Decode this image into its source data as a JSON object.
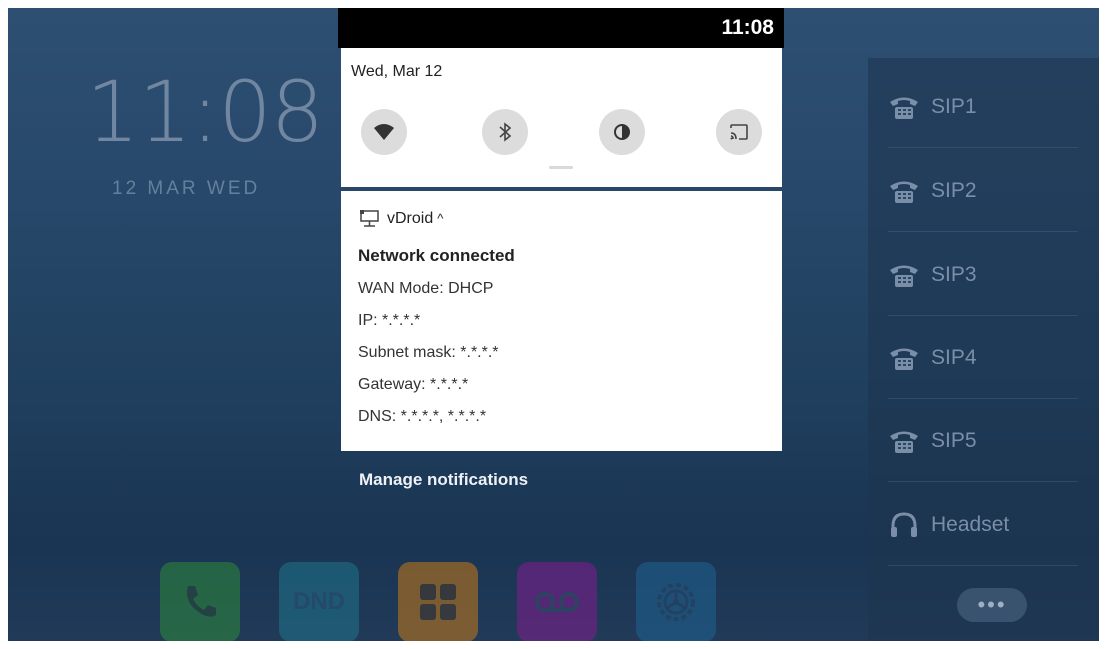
{
  "statusbar": {
    "time": "11:08"
  },
  "home": {
    "clock": "11:08",
    "date": "12 MAR WED"
  },
  "quick_settings": {
    "date": "Wed, Mar 12",
    "tiles": [
      {
        "icon": "wifi-icon"
      },
      {
        "icon": "bluetooth-icon"
      },
      {
        "icon": "contrast-icon"
      },
      {
        "icon": "cast-icon"
      }
    ]
  },
  "notification": {
    "app": "vDroid",
    "expand": "^",
    "title": "Network connected",
    "lines": [
      "WAN Mode: DHCP",
      "IP: *.*.*.*",
      "Subnet mask: *.*.*.*",
      "Gateway: *.*.*.*",
      "DNS: *.*.*.*, *.*.*.*"
    ]
  },
  "manage_notifications": "Manage notifications",
  "accounts": [
    {
      "label": "SIP1",
      "icon": "phone-icon"
    },
    {
      "label": "SIP2",
      "icon": "phone-icon"
    },
    {
      "label": "SIP3",
      "icon": "phone-icon"
    },
    {
      "label": "SIP4",
      "icon": "phone-icon"
    },
    {
      "label": "SIP5",
      "icon": "phone-icon"
    },
    {
      "label": "Headset",
      "icon": "headset-icon"
    }
  ],
  "more_button": "•••",
  "dock": [
    {
      "icon": "phone-handset-icon",
      "color": "#2e8a3a"
    },
    {
      "label": "DND",
      "icon": "dnd-icon",
      "color": "#1f6f86"
    },
    {
      "icon": "apps-grid-icon",
      "color": "#c77a16"
    },
    {
      "icon": "voicemail-icon",
      "color": "#7a1f8c"
    },
    {
      "icon": "settings-gear-icon",
      "color": "#1f5f8d"
    }
  ]
}
